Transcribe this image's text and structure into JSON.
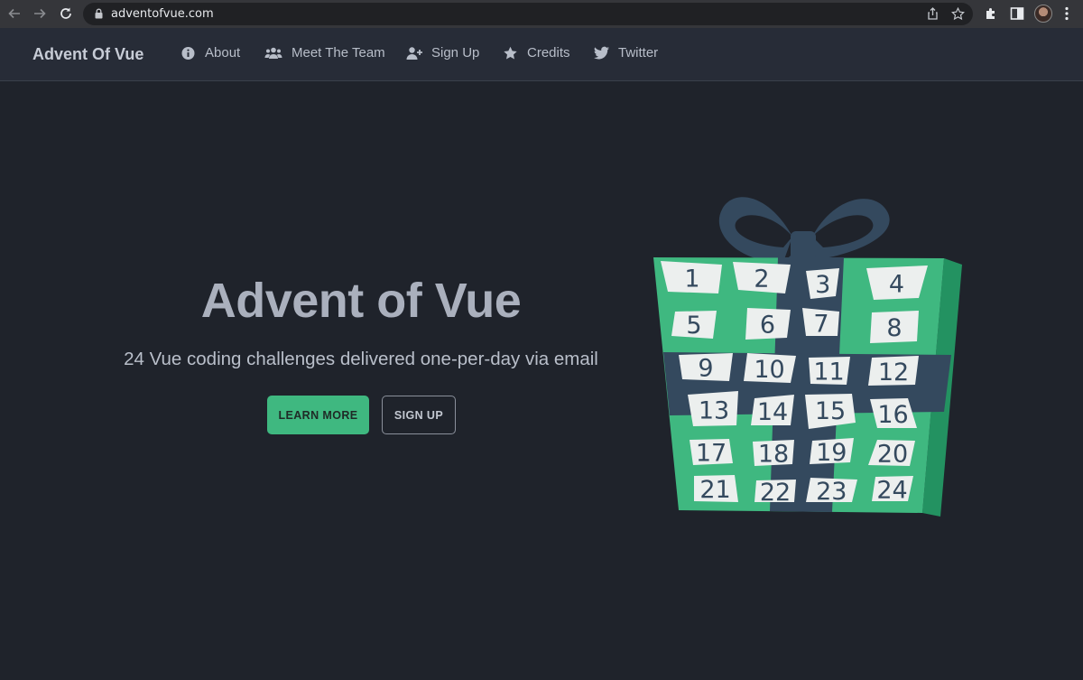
{
  "browser": {
    "url": "adventofvue.com",
    "icons": [
      "back-icon",
      "forward-icon",
      "reload-icon",
      "lock-icon",
      "share-icon",
      "bookmark-star-icon",
      "extensions-icon",
      "side-panel-icon",
      "profile-avatar",
      "menu-icon"
    ]
  },
  "nav": {
    "brand": "Advent Of Vue",
    "items": [
      {
        "label": "About",
        "icon": "info-circle-icon"
      },
      {
        "label": "Meet The Team",
        "icon": "users-icon"
      },
      {
        "label": "Sign Up",
        "icon": "user-plus-icon"
      },
      {
        "label": "Credits",
        "icon": "star-icon"
      },
      {
        "label": "Twitter",
        "icon": "twitter-icon"
      }
    ]
  },
  "hero": {
    "title": "Advent of Vue",
    "subtitle": "24 Vue coding challenges delivered one-per-day via email",
    "learn_more": "LEARN MORE",
    "sign_up": "SIGN UP"
  },
  "calendar": {
    "days": [
      "1",
      "2",
      "3",
      "4",
      "5",
      "6",
      "7",
      "8",
      "9",
      "10",
      "11",
      "12",
      "13",
      "14",
      "15",
      "16",
      "17",
      "18",
      "19",
      "20",
      "21",
      "22",
      "23",
      "24"
    ]
  },
  "colors": {
    "background": "#1f232b",
    "nav_background": "#272c37",
    "accent_green": "#3fb880",
    "gift_navy": "#34495e"
  }
}
